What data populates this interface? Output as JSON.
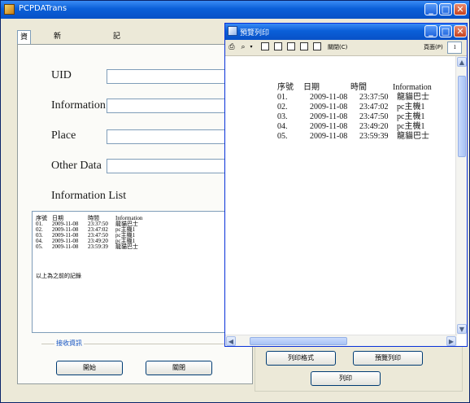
{
  "window": {
    "title": "PCPDATrans"
  },
  "tabs": [
    "資訊",
    "新增/更新/刪除",
    "記錄瀏覽"
  ],
  "form": {
    "uid_label": "UID",
    "information_label": "Information",
    "place_label": "Place",
    "other_label": "Other Data",
    "list_label": "Information List"
  },
  "list": {
    "headers": [
      "序號",
      "日期",
      "時間",
      "Information"
    ],
    "rows": [
      [
        "01.",
        "2009-11-08",
        "23:37:50",
        "龍貓巴士"
      ],
      [
        "02.",
        "2009-11-08",
        "23:47:02",
        "pc主機1"
      ],
      [
        "03.",
        "2009-11-08",
        "23:47:50",
        "pc主機1"
      ],
      [
        "04.",
        "2009-11-08",
        "23:49:20",
        "pc主機1"
      ],
      [
        "05.",
        "2009-11-08",
        "23:59:39",
        "龍貓巴士"
      ]
    ],
    "note": "以上為之前的記錄"
  },
  "group_label": "接收資訊",
  "buttons": {
    "start": "開始",
    "close": "關閉",
    "print_format": "列印格式",
    "preview_print": "預覽列印",
    "print": "列印"
  },
  "preview": {
    "title": "預覽列印",
    "close_label": "關閉(C)",
    "page_label": "頁面(P)",
    "page_value": "1",
    "headers": [
      "序號",
      "日期",
      "時間",
      "Information"
    ],
    "rows": [
      [
        "01.",
        "2009-11-08",
        "23:37:50",
        "龍貓巴士"
      ],
      [
        "02.",
        "2009-11-08",
        "23:47:02",
        "pc主機1"
      ],
      [
        "03.",
        "2009-11-08",
        "23:47:50",
        "pc主機1"
      ],
      [
        "04.",
        "2009-11-08",
        "23:49:20",
        "pc主機1"
      ],
      [
        "05.",
        "2009-11-08",
        "23:59:39",
        "龍貓巴士"
      ]
    ]
  },
  "icons": {
    "minimize": "_",
    "maximize": "□",
    "close": "✕",
    "print": "printer-icon",
    "zoom": "magnifier-icon"
  }
}
